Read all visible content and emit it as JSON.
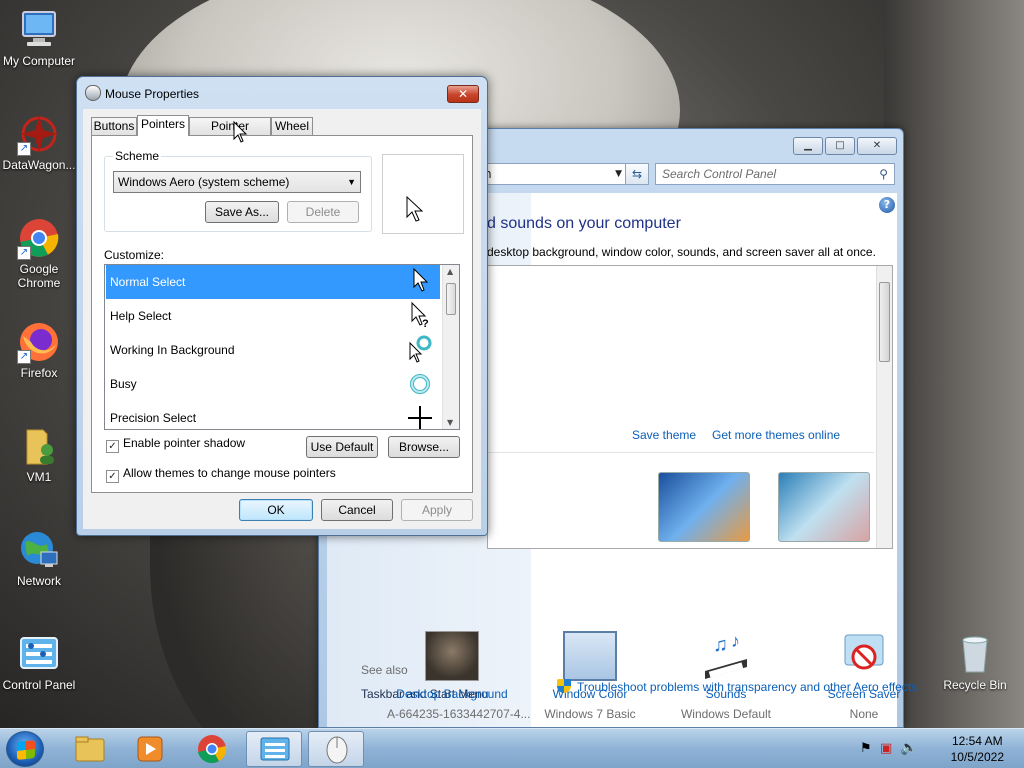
{
  "desktop": {
    "icons": [
      {
        "label": "My Computer",
        "icon": "computer-icon"
      },
      {
        "label": "DataWagon...",
        "icon": "datawagon-icon"
      },
      {
        "label": "Google Chrome",
        "icon": "chrome-icon"
      },
      {
        "label": "Firefox",
        "icon": "firefox-icon"
      },
      {
        "label": "VM1",
        "icon": "folder-user-icon"
      },
      {
        "label": "Network",
        "icon": "network-icon"
      },
      {
        "label": "Control Panel",
        "icon": "control-panel-icon"
      }
    ],
    "recycle_bin": "Recycle Bin"
  },
  "control_panel": {
    "address_text": "n",
    "search_placeholder": "Search Control Panel",
    "heading": "d sounds on your computer",
    "subtext": "desktop background, window color, sounds, and screen saver all at once.",
    "save_theme": "Save theme",
    "get_more_themes": "Get more themes online",
    "bottom_items": [
      {
        "label": "Desktop Background",
        "value": "A-664235-1633442707-4..."
      },
      {
        "label": "Window Color",
        "value": "Windows 7 Basic"
      },
      {
        "label": "Sounds",
        "value": "Windows Default"
      },
      {
        "label": "Screen Saver",
        "value": "None"
      }
    ],
    "see_also": "See also",
    "see_also_link": "Taskbar and Start Menu",
    "troubleshoot": "Troubleshoot problems with transparency and other Aero effects"
  },
  "mouse_properties": {
    "title": "Mouse Properties",
    "tabs": [
      "Buttons",
      "Pointers",
      "Pointer Options",
      "Wheel"
    ],
    "selected_tab": "Pointers",
    "scheme_label": "Scheme",
    "scheme_value": "Windows Aero (system scheme)",
    "save_as": "Save As...",
    "delete": "Delete",
    "customize_label": "Customize:",
    "cursors": [
      {
        "name": "Normal Select",
        "icon": "arrow-cursor-icon"
      },
      {
        "name": "Help Select",
        "icon": "help-cursor-icon"
      },
      {
        "name": "Working In Background",
        "icon": "working-cursor-icon"
      },
      {
        "name": "Busy",
        "icon": "busy-cursor-icon"
      },
      {
        "name": "Precision Select",
        "icon": "crosshair-cursor-icon"
      }
    ],
    "enable_shadow": "Enable pointer shadow",
    "allow_themes": "Allow themes to change mouse pointers",
    "use_default": "Use Default",
    "browse": "Browse...",
    "ok": "OK",
    "cancel": "Cancel",
    "apply": "Apply"
  },
  "taskbar": {
    "time": "12:54 AM",
    "date": "10/5/2022"
  }
}
